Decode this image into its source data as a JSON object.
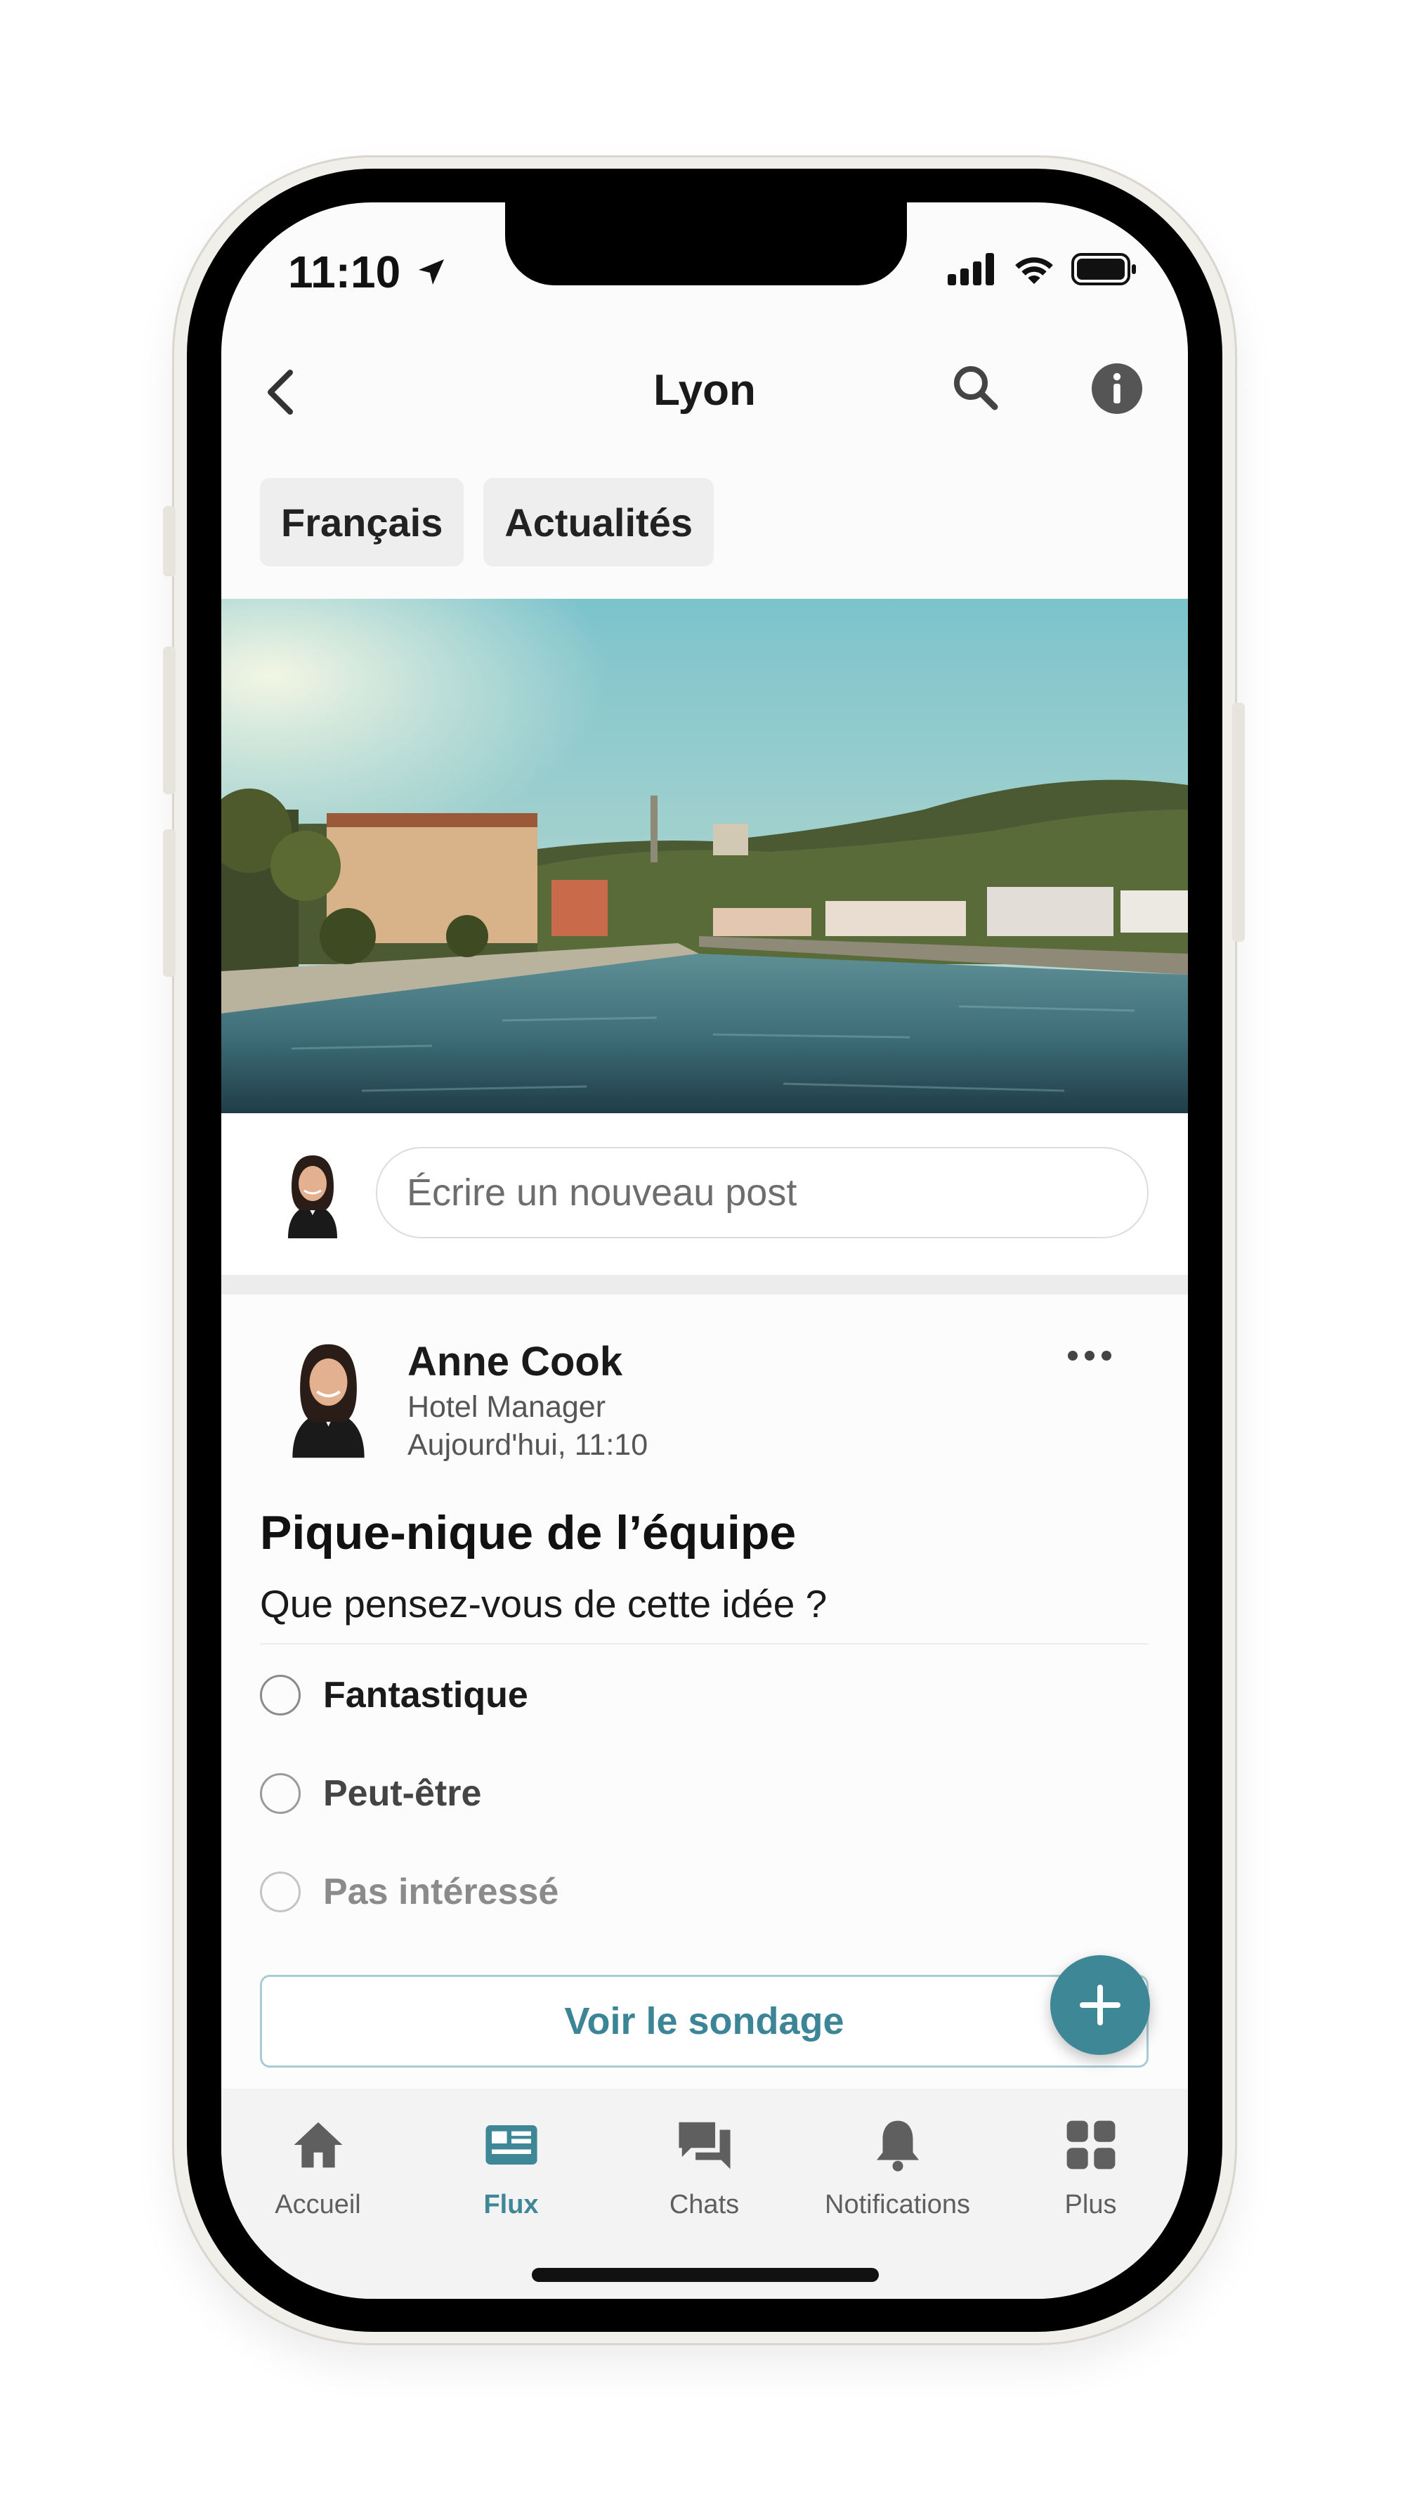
{
  "status_bar": {
    "time": "11:10",
    "icons": [
      "location-arrow-icon",
      "signal-icon",
      "wifi-icon",
      "battery-icon"
    ]
  },
  "nav": {
    "title": "Lyon",
    "icons": [
      "back-chevron-icon",
      "search-icon",
      "info-icon"
    ]
  },
  "chips": [
    {
      "label": "Français"
    },
    {
      "label": "Actualités"
    }
  ],
  "hero_image": {
    "description_icon": "city-river-photo"
  },
  "composer": {
    "placeholder": "Écrire un nouveau post"
  },
  "post": {
    "author": "Anne Cook",
    "role": "Hotel Manager",
    "timestamp": "Aujourd'hui, 11:10",
    "title": "Pique-nique de l’équipe",
    "question": "Que pensez-vous de cette idée ?",
    "options": [
      {
        "label": "Fantastique"
      },
      {
        "label": "Peut-être"
      },
      {
        "label": "Pas intéressé"
      }
    ],
    "vote_button": "Voir le sondage"
  },
  "tab_bar": {
    "items": [
      {
        "label": "Accueil",
        "icon": "home-icon",
        "active": false
      },
      {
        "label": "Flux",
        "icon": "feed-icon",
        "active": true
      },
      {
        "label": "Chats",
        "icon": "chat-icon",
        "active": false
      },
      {
        "label": "Notifications",
        "icon": "bell-icon",
        "active": false
      },
      {
        "label": "Plus",
        "icon": "grid-icon",
        "active": false
      }
    ]
  },
  "colors": {
    "accent": "#3e8797",
    "chip_bg": "#eeeeee",
    "screen_bg": "#fbfbfb",
    "text_dark": "#1a1a1a"
  }
}
